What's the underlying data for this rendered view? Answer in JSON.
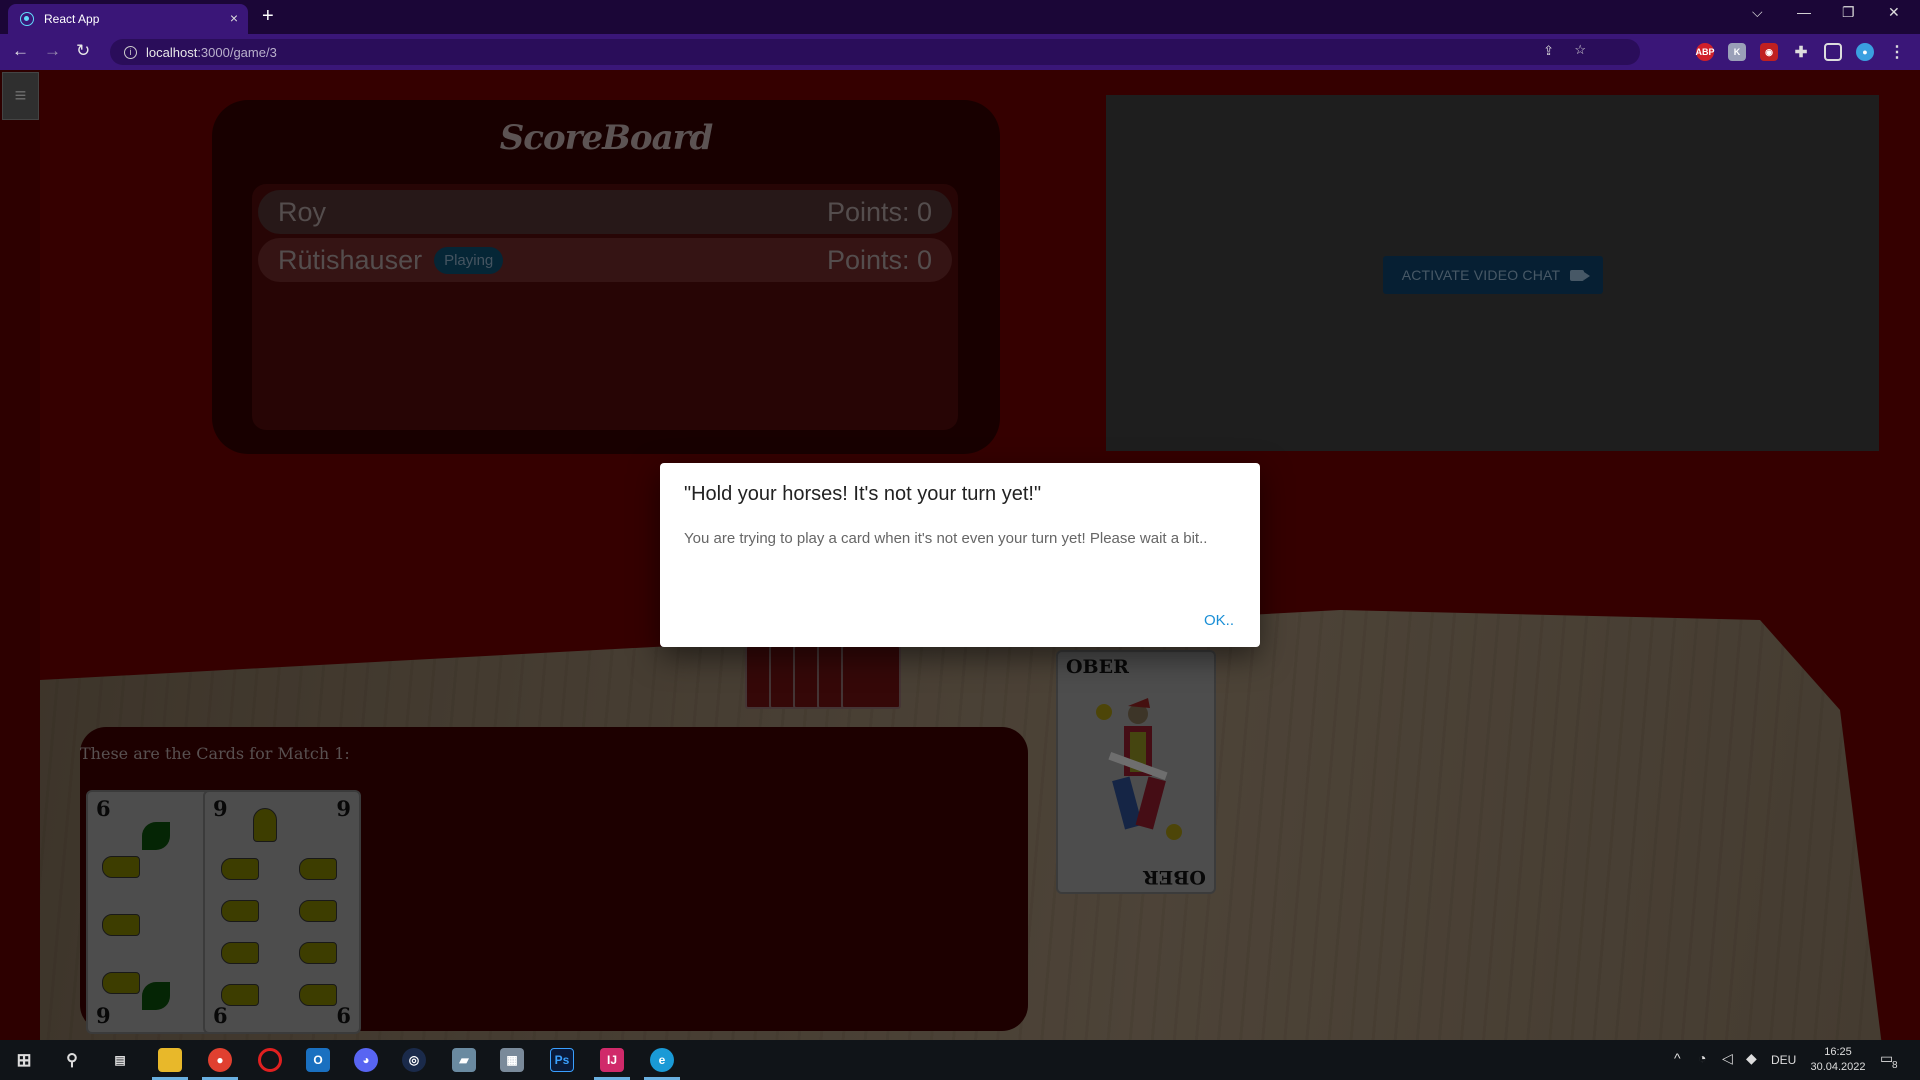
{
  "browser": {
    "tab_title": "React App",
    "tab_close": "×",
    "new_tab": "+",
    "url_host": "localhost",
    "url_path": ":3000/game/3",
    "extensions": [
      "abp-icon",
      "translate-icon",
      "recorder-icon",
      "puzzle-icon",
      "sidepanel-icon",
      "profile-icon"
    ],
    "ext_labels": {
      "abp": "ABP"
    }
  },
  "scoreboard": {
    "title": "ScoreBoard",
    "players": [
      {
        "name": "Roy",
        "points": "Points: 0",
        "status": ""
      },
      {
        "name": "Rütishauser",
        "points": "Points: 0",
        "status": "Playing"
      }
    ]
  },
  "video": {
    "button_label": "ACTIVATE VIDEO CHAT"
  },
  "hand": {
    "label": "These are the Cards for Match 1:",
    "cards": [
      {
        "rank_top": "6",
        "rank_bottom": "9"
      },
      {
        "rank_top": "9",
        "rank_top_right": "9",
        "rank_bottom": "6",
        "rank_bottom_right": "6"
      }
    ]
  },
  "table_card": {
    "top_label": "OBER",
    "bottom_label": "OBER"
  },
  "dialog": {
    "title": "\"Hold your horses! It's not your turn yet!\"",
    "text": "You are trying to play a card when it's not even your turn yet! Please wait a bit..",
    "ok_label": "OK.."
  },
  "taskbar": {
    "lang": "DEU",
    "time": "16:25",
    "date": "30.04.2022",
    "notification_count": "8"
  },
  "colors": {
    "accent": "#1a8fd6",
    "page_bg": "#6a0000",
    "badge": "#0a4c6c"
  }
}
